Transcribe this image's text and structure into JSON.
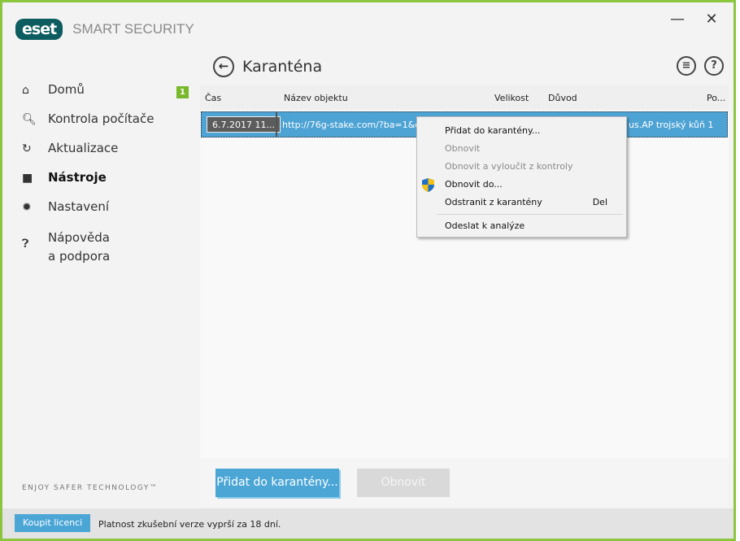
{
  "app": {
    "logo": "eset",
    "product": "SMART SECURITY",
    "minimize": "—",
    "close": "✕"
  },
  "sidebar": {
    "items": [
      {
        "label": "Domů",
        "icon": "home-icon",
        "badge": "1"
      },
      {
        "label": "Kontrola počítače",
        "icon": "search-icon"
      },
      {
        "label": "Aktualizace",
        "icon": "refresh-icon"
      },
      {
        "label": "Nástroje",
        "icon": "toolbox-icon",
        "active": true
      },
      {
        "label": "Nastavení",
        "icon": "gear-icon"
      },
      {
        "label": "Nápověda",
        "label2": "a podpora",
        "icon": "help-icon"
      }
    ],
    "slogan": "ENJOY SAFER TECHNOLOGY™"
  },
  "main": {
    "title": "Karanténa",
    "table": {
      "columns": [
        "Čas",
        "Název objektu",
        "Velikost",
        "Důvod",
        "Po..."
      ],
      "rows": [
        {
          "time": "6.7.2017 11...",
          "name": "http://76g-stake.com/?ba=1&dm",
          "reason": "us.AP trojský kůň 1"
        }
      ]
    },
    "buttons": {
      "add": "Přidat do karantény...",
      "restore": "Obnovit"
    }
  },
  "context_menu": {
    "items": [
      {
        "label": "Přidat do karantény...",
        "enabled": true
      },
      {
        "label": "Obnovit",
        "enabled": false
      },
      {
        "label": "Obnovit a vyloučit z kontroly",
        "enabled": false
      },
      {
        "label": "Obnovit do...",
        "enabled": true,
        "icon": "uac-shield-icon"
      },
      {
        "label": "Odstranit z karantény",
        "enabled": true,
        "shortcut": "Del"
      },
      {
        "label": "Odeslat k analýze",
        "enabled": true
      }
    ]
  },
  "footer": {
    "buy": "Koupit licenci",
    "text": "Platnost zkušební verze vyprší za 18 dní."
  },
  "colors": {
    "accent": "#4ba6d6",
    "border": "#8cc63e",
    "brand": "#0c5c60"
  }
}
